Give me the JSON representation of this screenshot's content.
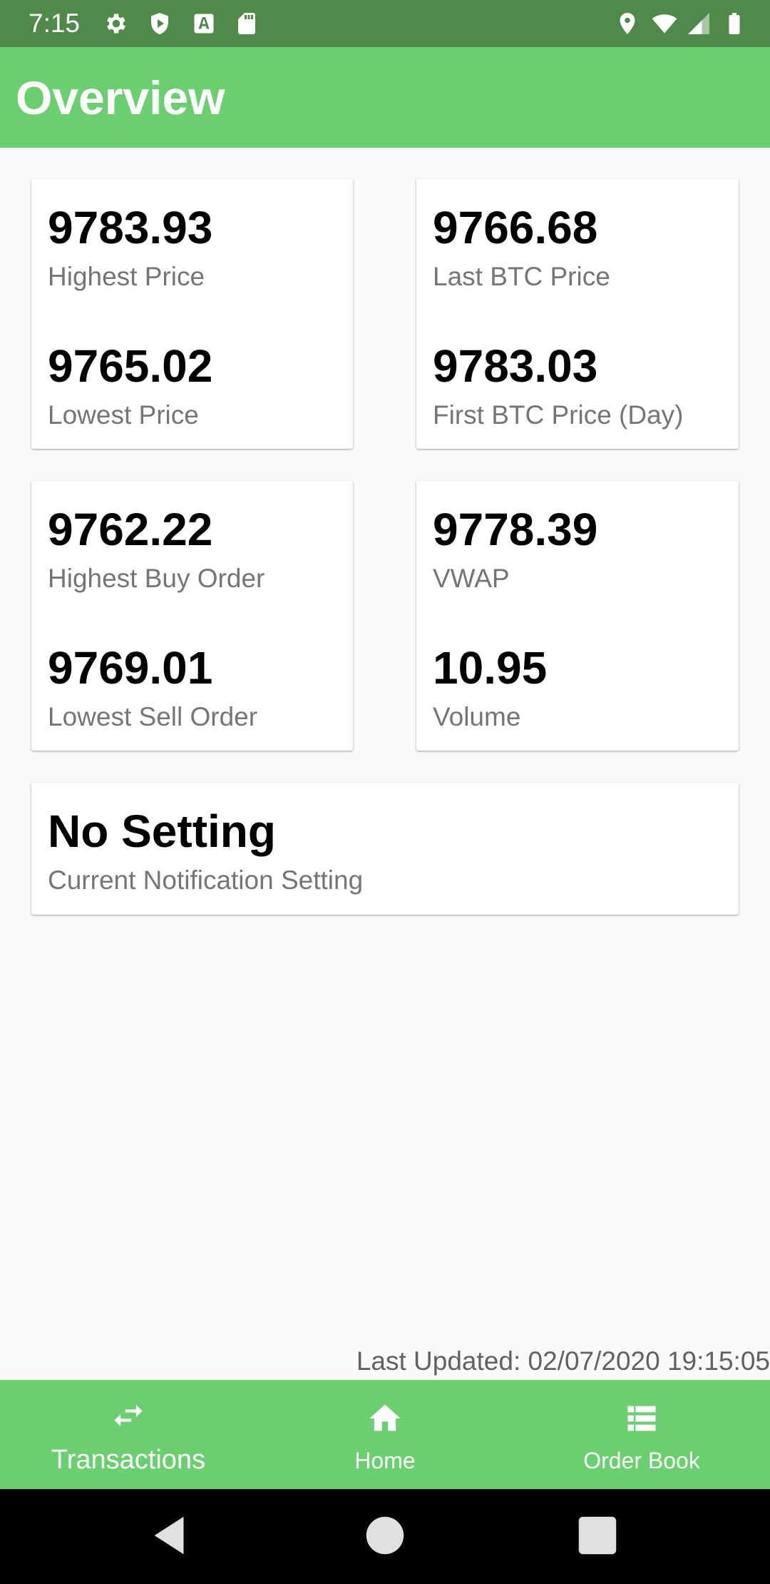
{
  "status_bar": {
    "time": "7:15",
    "icons_left": [
      "gear-icon",
      "play-shield-icon",
      "font-a-icon",
      "sd-card-icon"
    ],
    "icons_right": [
      "location-pin-icon",
      "wifi-icon",
      "signal-icon",
      "battery-icon"
    ]
  },
  "app_bar": {
    "title": "Overview"
  },
  "cards": [
    {
      "value": "9783.93",
      "label": "Highest Price"
    },
    {
      "value": "9765.02",
      "label": "Lowest Price"
    },
    {
      "value": "9766.68",
      "label": "Last BTC Price"
    },
    {
      "value": "9783.03",
      "label": "First BTC Price (Day)"
    },
    {
      "value": "9762.22",
      "label": "Highest Buy Order"
    },
    {
      "value": "9769.01",
      "label": "Lowest Sell Order"
    },
    {
      "value": "9778.39",
      "label": "VWAP"
    },
    {
      "value": "10.95",
      "label": "Volume"
    }
  ],
  "notification_card": {
    "value": "No Setting",
    "label": "Current Notification Setting"
  },
  "last_updated": "Last Updated: 02/07/2020 19:15:05",
  "bottom_nav": {
    "items": [
      {
        "label": "Transactions",
        "icon": "swap-arrows-icon",
        "active": true
      },
      {
        "label": "Home",
        "icon": "home-icon",
        "active": false
      },
      {
        "label": "Order Book",
        "icon": "list-icon",
        "active": false
      }
    ]
  },
  "colors": {
    "status_bar": "#4f8a4b",
    "accent": "#6acf6e",
    "background": "#fafafa"
  }
}
